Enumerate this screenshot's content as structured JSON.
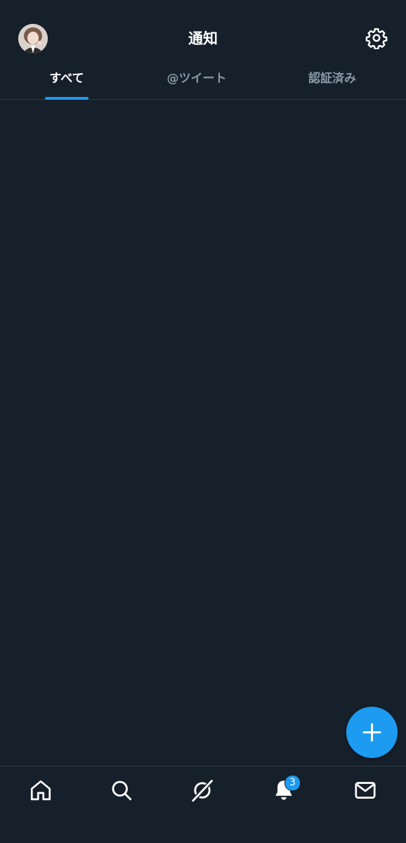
{
  "header": {
    "title": "通知",
    "avatar_icon": "user-avatar",
    "settings_icon": "gear-icon"
  },
  "tabs": [
    {
      "label": "すべて",
      "active": true
    },
    {
      "label": "@ツイート",
      "active": false
    },
    {
      "label": "認証済み",
      "active": false
    }
  ],
  "fab": {
    "icon": "plus-icon"
  },
  "bottom_nav": {
    "items": [
      {
        "icon": "home-icon"
      },
      {
        "icon": "search-icon"
      },
      {
        "icon": "spaces-icon"
      },
      {
        "icon": "bell-icon",
        "badge": "3"
      },
      {
        "icon": "mail-icon"
      }
    ]
  },
  "colors": {
    "background": "#16202b",
    "accent": "#1d9bf0",
    "muted_text": "#8899a6",
    "divider": "#2f3b47"
  }
}
